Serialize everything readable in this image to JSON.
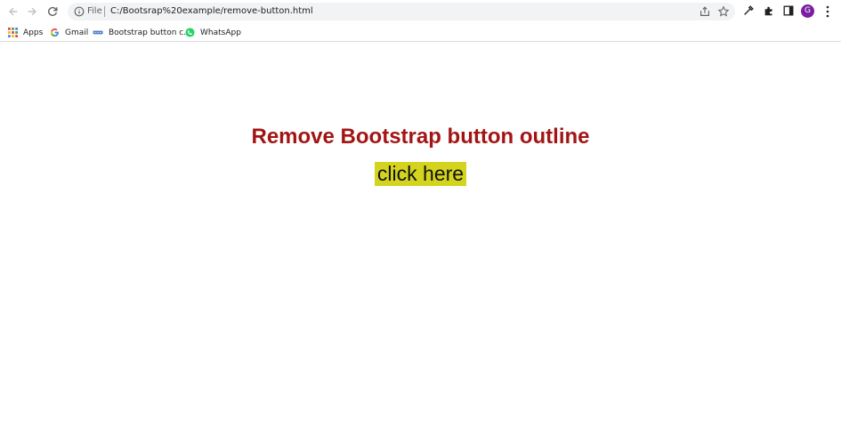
{
  "browser": {
    "scheme_label": "File",
    "url": "C:/Bootsrap%20example/remove-button.html",
    "avatar_letter": "G",
    "avatar_color": "#7b1fa2"
  },
  "bookmarks": [
    {
      "label": "Apps",
      "icon": "apps-grid-icon"
    },
    {
      "label": "Gmail",
      "icon": "google-icon"
    },
    {
      "label": "Bootstrap button c...",
      "icon": "site-favicon-icon"
    },
    {
      "label": "WhatsApp",
      "icon": "whatsapp-icon"
    }
  ],
  "page": {
    "heading": "Remove Bootstrap button outline",
    "button_label": "click here",
    "heading_color": "#a31515",
    "button_color": "#d4d41e"
  }
}
